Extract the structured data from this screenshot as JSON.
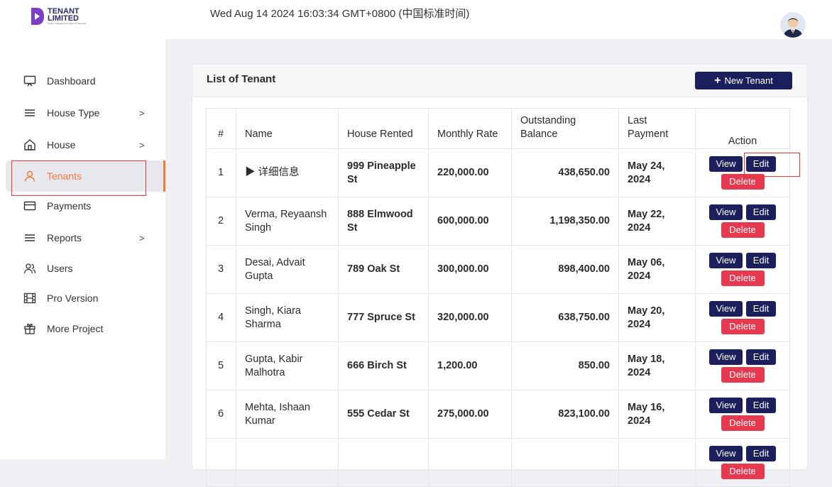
{
  "brand": {
    "title_line1": "TENANT",
    "title_line2": "LIMITED",
    "tagline": "Tenant management system by Mayuri K."
  },
  "header": {
    "datetime": "Wed Aug 14 2024 16:03:34 GMT+0800 (中国标准时间)"
  },
  "sidebar": {
    "items": [
      {
        "label": "Dashboard",
        "icon": "monitor-icon",
        "chevron": ""
      },
      {
        "label": "House Type",
        "icon": "list-icon",
        "chevron": ">"
      },
      {
        "label": "House",
        "icon": "home-icon",
        "chevron": ">"
      },
      {
        "label": "Tenants",
        "icon": "user-icon",
        "chevron": ""
      },
      {
        "label": "Payments",
        "icon": "card-icon",
        "chevron": ""
      },
      {
        "label": "Reports",
        "icon": "list-icon",
        "chevron": ">"
      },
      {
        "label": "Users",
        "icon": "users-icon",
        "chevron": ""
      },
      {
        "label": "Pro Version",
        "icon": "film-icon",
        "chevron": ""
      },
      {
        "label": "More Project",
        "icon": "gift-icon",
        "chevron": ""
      }
    ],
    "active": "Tenants"
  },
  "main": {
    "title": "List of Tenant",
    "new_button": "New Tenant",
    "columns": [
      "#",
      "Name",
      "House Rented",
      "Monthly Rate",
      "Outstanding Balance",
      "Last Payment",
      "Action"
    ],
    "actions": {
      "view": "View",
      "edit": "Edit",
      "delete": "Delete"
    },
    "rows": [
      {
        "num": "1",
        "name": "▶ 详细信息",
        "house": "999 Pineapple St",
        "rate": "220,000.00",
        "balance": "438,650.00",
        "last_payment": "May 24, 2024"
      },
      {
        "num": "2",
        "name": "Verma, Reyaansh Singh",
        "house": "888 Elmwood St",
        "rate": "600,000.00",
        "balance": "1,198,350.00",
        "last_payment": "May 22, 2024"
      },
      {
        "num": "3",
        "name": "Desai, Advait Gupta",
        "house": "789 Oak St",
        "rate": "300,000.00",
        "balance": "898,400.00",
        "last_payment": "May 06, 2024"
      },
      {
        "num": "4",
        "name": "Singh, Kiara Sharma",
        "house": "777 Spruce St",
        "rate": "320,000.00",
        "balance": "638,750.00",
        "last_payment": "May 20, 2024"
      },
      {
        "num": "5",
        "name": "Gupta, Kabir Malhotra",
        "house": "666 Birch St",
        "rate": "1,200.00",
        "balance": "850.00",
        "last_payment": "May 18, 2024"
      },
      {
        "num": "6",
        "name": "Mehta, Ishaan Kumar",
        "house": "555 Cedar St",
        "rate": "275,000.00",
        "balance": "823,100.00",
        "last_payment": "May 16, 2024"
      },
      {
        "num": "",
        "name": "",
        "house": "",
        "rate": "",
        "balance": "",
        "last_payment": ""
      }
    ]
  },
  "colors": {
    "primary": "#1b1f5c",
    "danger": "#e53950",
    "accent": "#f07a3b",
    "highlight": "#e53935"
  }
}
